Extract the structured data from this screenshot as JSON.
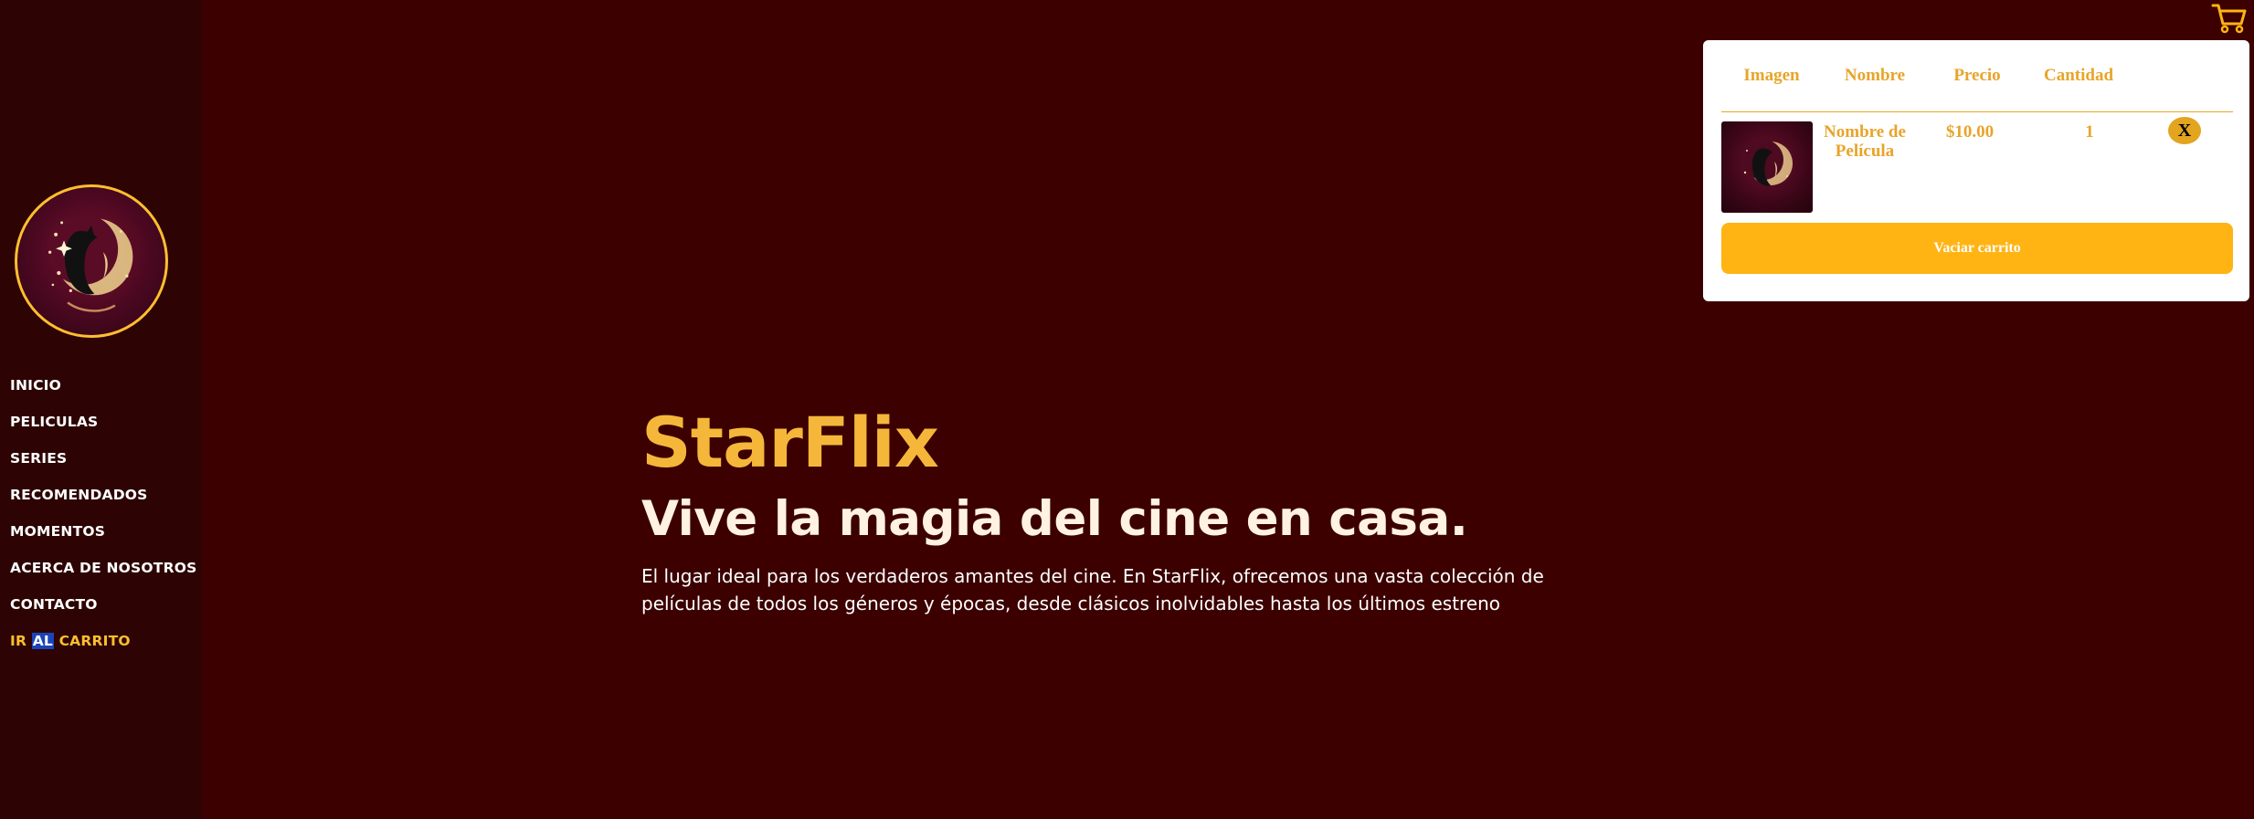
{
  "nav": {
    "items": [
      "INICIO",
      "PELICULAS",
      "SERIES",
      "RECOMENDADOS",
      "MOMENTOS",
      "ACERCA DE NOSOTROS",
      "CONTACTO"
    ],
    "cart_link": {
      "part1": "IR ",
      "part2": "AL",
      "part3": " CARRITO"
    }
  },
  "hero": {
    "brand": "StarFlix",
    "tagline": "Vive la magia del cine en casa.",
    "description": "El lugar ideal para los verdaderos amantes del cine. En StarFlix, ofrecemos una vasta colección de películas de todos los géneros y épocas, desde clásicos inolvidables hasta los últimos estreno"
  },
  "cart": {
    "headers": {
      "image": "Imagen",
      "name": "Nombre",
      "price": "Precio",
      "quantity": "Cantidad"
    },
    "rows": [
      {
        "name": "Nombre de Película",
        "price": "$10.00",
        "quantity": "1",
        "remove": "X"
      }
    ],
    "empty_label": "Vaciar carrito"
  },
  "colors": {
    "background": "#3c0000",
    "sidebar": "#2d0303",
    "accent": "#ffbf2e",
    "cart_text": "#e8a42a"
  },
  "icons": {
    "cart": "shopping-cart-icon",
    "logo": "starflix-logo"
  }
}
